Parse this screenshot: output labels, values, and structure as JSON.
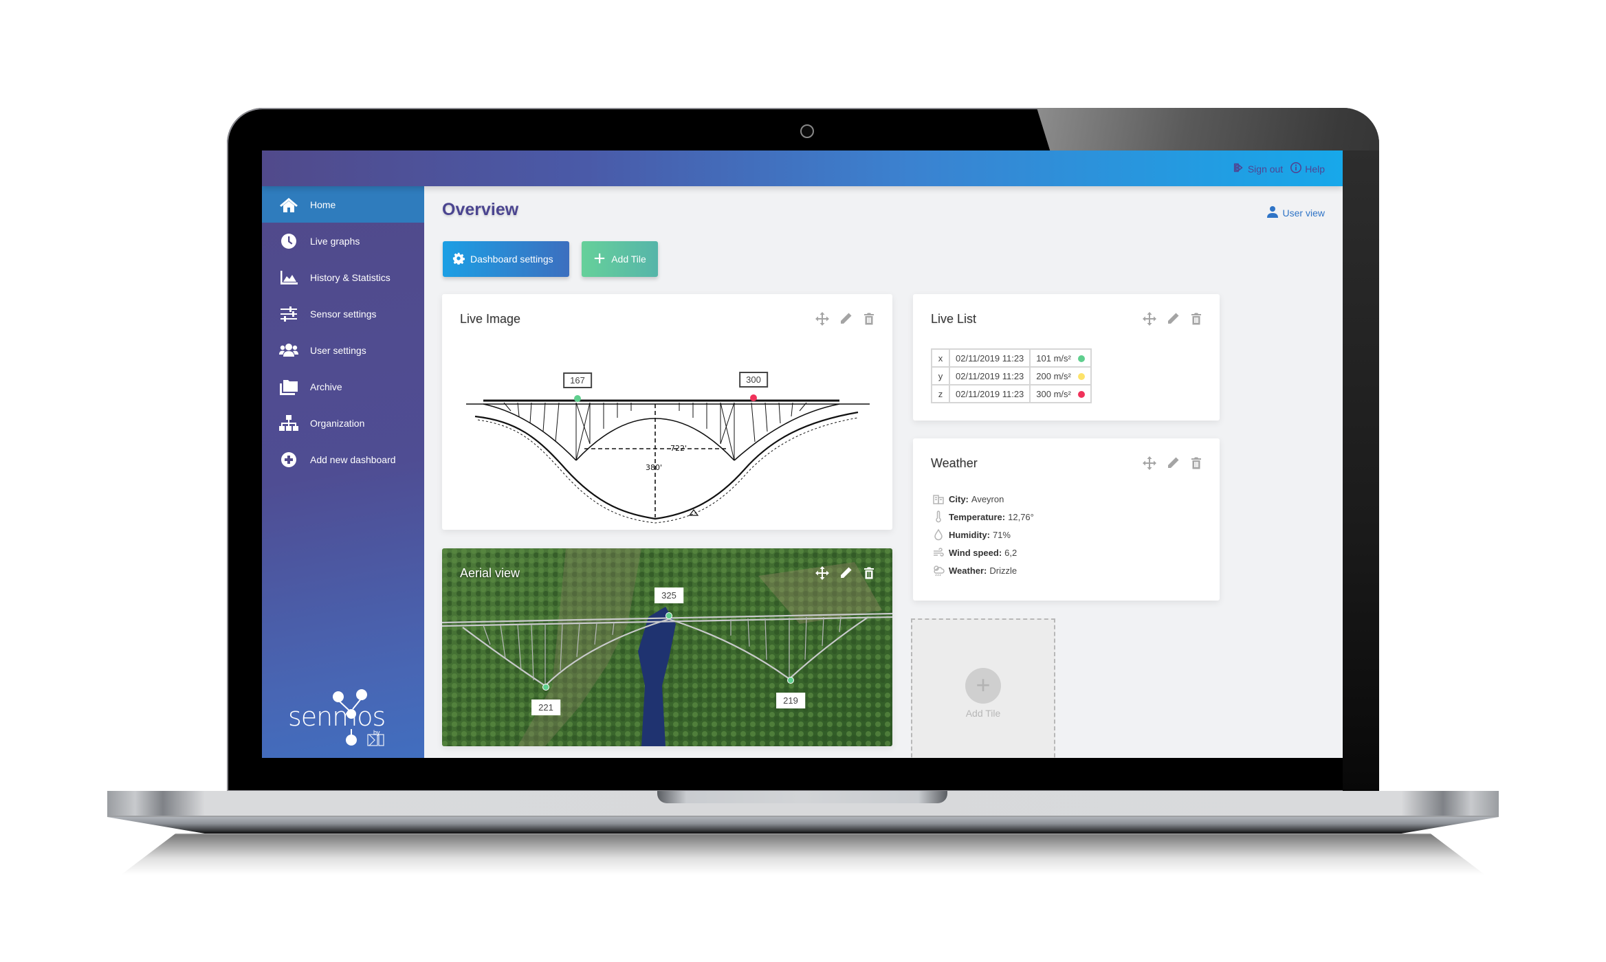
{
  "header": {
    "sign_out": "Sign out",
    "help": "Help"
  },
  "sidebar": {
    "items": [
      {
        "label": "Home",
        "icon": "home-icon",
        "active": true
      },
      {
        "label": "Live graphs",
        "icon": "clock-icon"
      },
      {
        "label": "History & Statistics",
        "icon": "area-chart-icon"
      },
      {
        "label": "Sensor settings",
        "icon": "sliders-icon"
      },
      {
        "label": "User settings",
        "icon": "users-icon"
      },
      {
        "label": "Archive",
        "icon": "folders-icon"
      },
      {
        "label": "Organization",
        "icon": "sitemap-icon"
      },
      {
        "label": "Add new dashboard",
        "icon": "plus-circle-icon"
      }
    ],
    "logo": {
      "text": "senmos",
      "by": "by"
    }
  },
  "main": {
    "title": "Overview",
    "user_view": "User view",
    "buttons": {
      "dashboard_settings": "Dashboard settings",
      "add_tile": "Add Tile"
    }
  },
  "tiles": {
    "live_image": {
      "title": "Live Image",
      "markers": [
        {
          "value": "167",
          "color": "#5fcf8e"
        },
        {
          "value": "300",
          "color": "#f0325a"
        }
      ],
      "drawing_labels": {
        "span": "722'",
        "height": "380'"
      }
    },
    "aerial_view": {
      "title": "Aerial view",
      "markers": [
        {
          "value": "325",
          "color": "#5fcf8e"
        },
        {
          "value": "221",
          "color": "#5fcf8e"
        },
        {
          "value": "219",
          "color": "#5fcf8e"
        }
      ]
    },
    "live_list": {
      "title": "Live List",
      "rows": [
        {
          "axis": "x",
          "timestamp": "02/11/2019 11:23",
          "value": "101 m/s²",
          "status_color": "#5fcf8e"
        },
        {
          "axis": "y",
          "timestamp": "02/11/2019 11:23",
          "value": "200 m/s²",
          "status_color": "#fde36a"
        },
        {
          "axis": "z",
          "timestamp": "02/11/2019 11:23",
          "value": "300 m/s²",
          "status_color": "#f0325a"
        }
      ]
    },
    "weather": {
      "title": "Weather",
      "rows": [
        {
          "label": "City:",
          "value": "Aveyron",
          "icon": "city-icon"
        },
        {
          "label": "Temperature:",
          "value": "12,76°",
          "icon": "thermometer-icon"
        },
        {
          "label": "Humidity:",
          "value": "71%",
          "icon": "droplet-icon"
        },
        {
          "label": "Wind speed:",
          "value": "6,2",
          "icon": "wind-icon"
        },
        {
          "label": "Weather:",
          "value": "Drizzle",
          "icon": "drizzle-icon"
        }
      ]
    },
    "add_tile_placeholder": {
      "label": "Add Tile",
      "symbol": "+"
    }
  },
  "colors": {
    "brand_purple": "#514a8b",
    "brand_blue": "#17a8ea",
    "active_nav": "#2f7cbd",
    "settings_button": "#1c9fe4",
    "add_button": "#66d09a"
  }
}
